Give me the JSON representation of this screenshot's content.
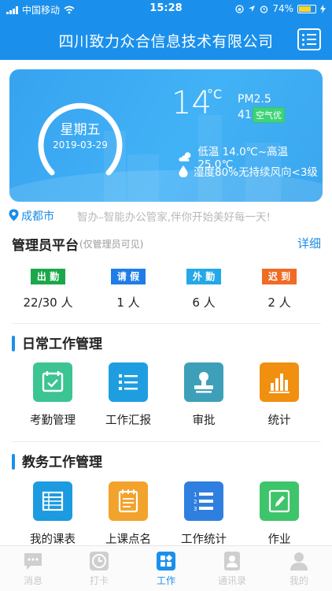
{
  "status_bar": {
    "carrier": "中国移动",
    "time": "15:28",
    "battery_percent": "74%",
    "battery_level": 0.74
  },
  "header": {
    "title": "四川致力众合信息技术有限公司",
    "menu_icon": "list-icon"
  },
  "weather": {
    "weekday": "星期五",
    "date": "2019-03-29",
    "temperature": "14",
    "temperature_unit": "°C",
    "pm_label": "PM2.5",
    "pm_value": "41",
    "air_quality": "空气优",
    "temp_range": "低温 14.0℃~高温 25.0℃",
    "humidity_wind": "湿度80%无持续风向<3级"
  },
  "location": {
    "city": "成都市",
    "slogan": "智办–智能办公管家,伴你开始美好每一天!"
  },
  "admin": {
    "title": "管理员平台",
    "subtitle": "(仅管理员可见)",
    "detail_label": "详细",
    "stats": [
      {
        "label": "出 勤",
        "value": "22/30 人",
        "color": "#1aa84a"
      },
      {
        "label": "请 假",
        "value": "1 人",
        "color": "#1f7de8"
      },
      {
        "label": "外 勤",
        "value": "6 人",
        "color": "#24a8e8"
      },
      {
        "label": "迟 到",
        "value": "2 人",
        "color": "#f06b24"
      }
    ]
  },
  "daily": {
    "title": "日常工作管理",
    "items": [
      {
        "label": "考勤管理",
        "icon": "calendar-check-icon",
        "color": "#3cc493"
      },
      {
        "label": "工作汇报",
        "icon": "report-list-icon",
        "color": "#1e9ee0"
      },
      {
        "label": "审批",
        "icon": "stamp-icon",
        "color": "#3da0b8"
      },
      {
        "label": "统计",
        "icon": "bar-chart-icon",
        "color": "#f08f10"
      }
    ]
  },
  "teaching": {
    "title": "教务工作管理",
    "items": [
      {
        "label": "我的课表",
        "icon": "timetable-icon",
        "color": "#1c9be0"
      },
      {
        "label": "上课点名",
        "icon": "roll-call-icon",
        "color": "#f3a22c"
      },
      {
        "label": "工作统计",
        "icon": "numbered-list-icon",
        "color": "#2f7fe0"
      },
      {
        "label": "作业",
        "icon": "homework-edit-icon",
        "color": "#3ec46a"
      }
    ]
  },
  "tabbar": {
    "tabs": [
      {
        "label": "消息",
        "icon": "message-icon",
        "active": false
      },
      {
        "label": "打卡",
        "icon": "clock-icon",
        "active": false
      },
      {
        "label": "工作",
        "icon": "grid-icon",
        "active": true
      },
      {
        "label": "通讯录",
        "icon": "contacts-icon",
        "active": false
      },
      {
        "label": "我的",
        "icon": "person-icon",
        "active": false
      }
    ]
  }
}
